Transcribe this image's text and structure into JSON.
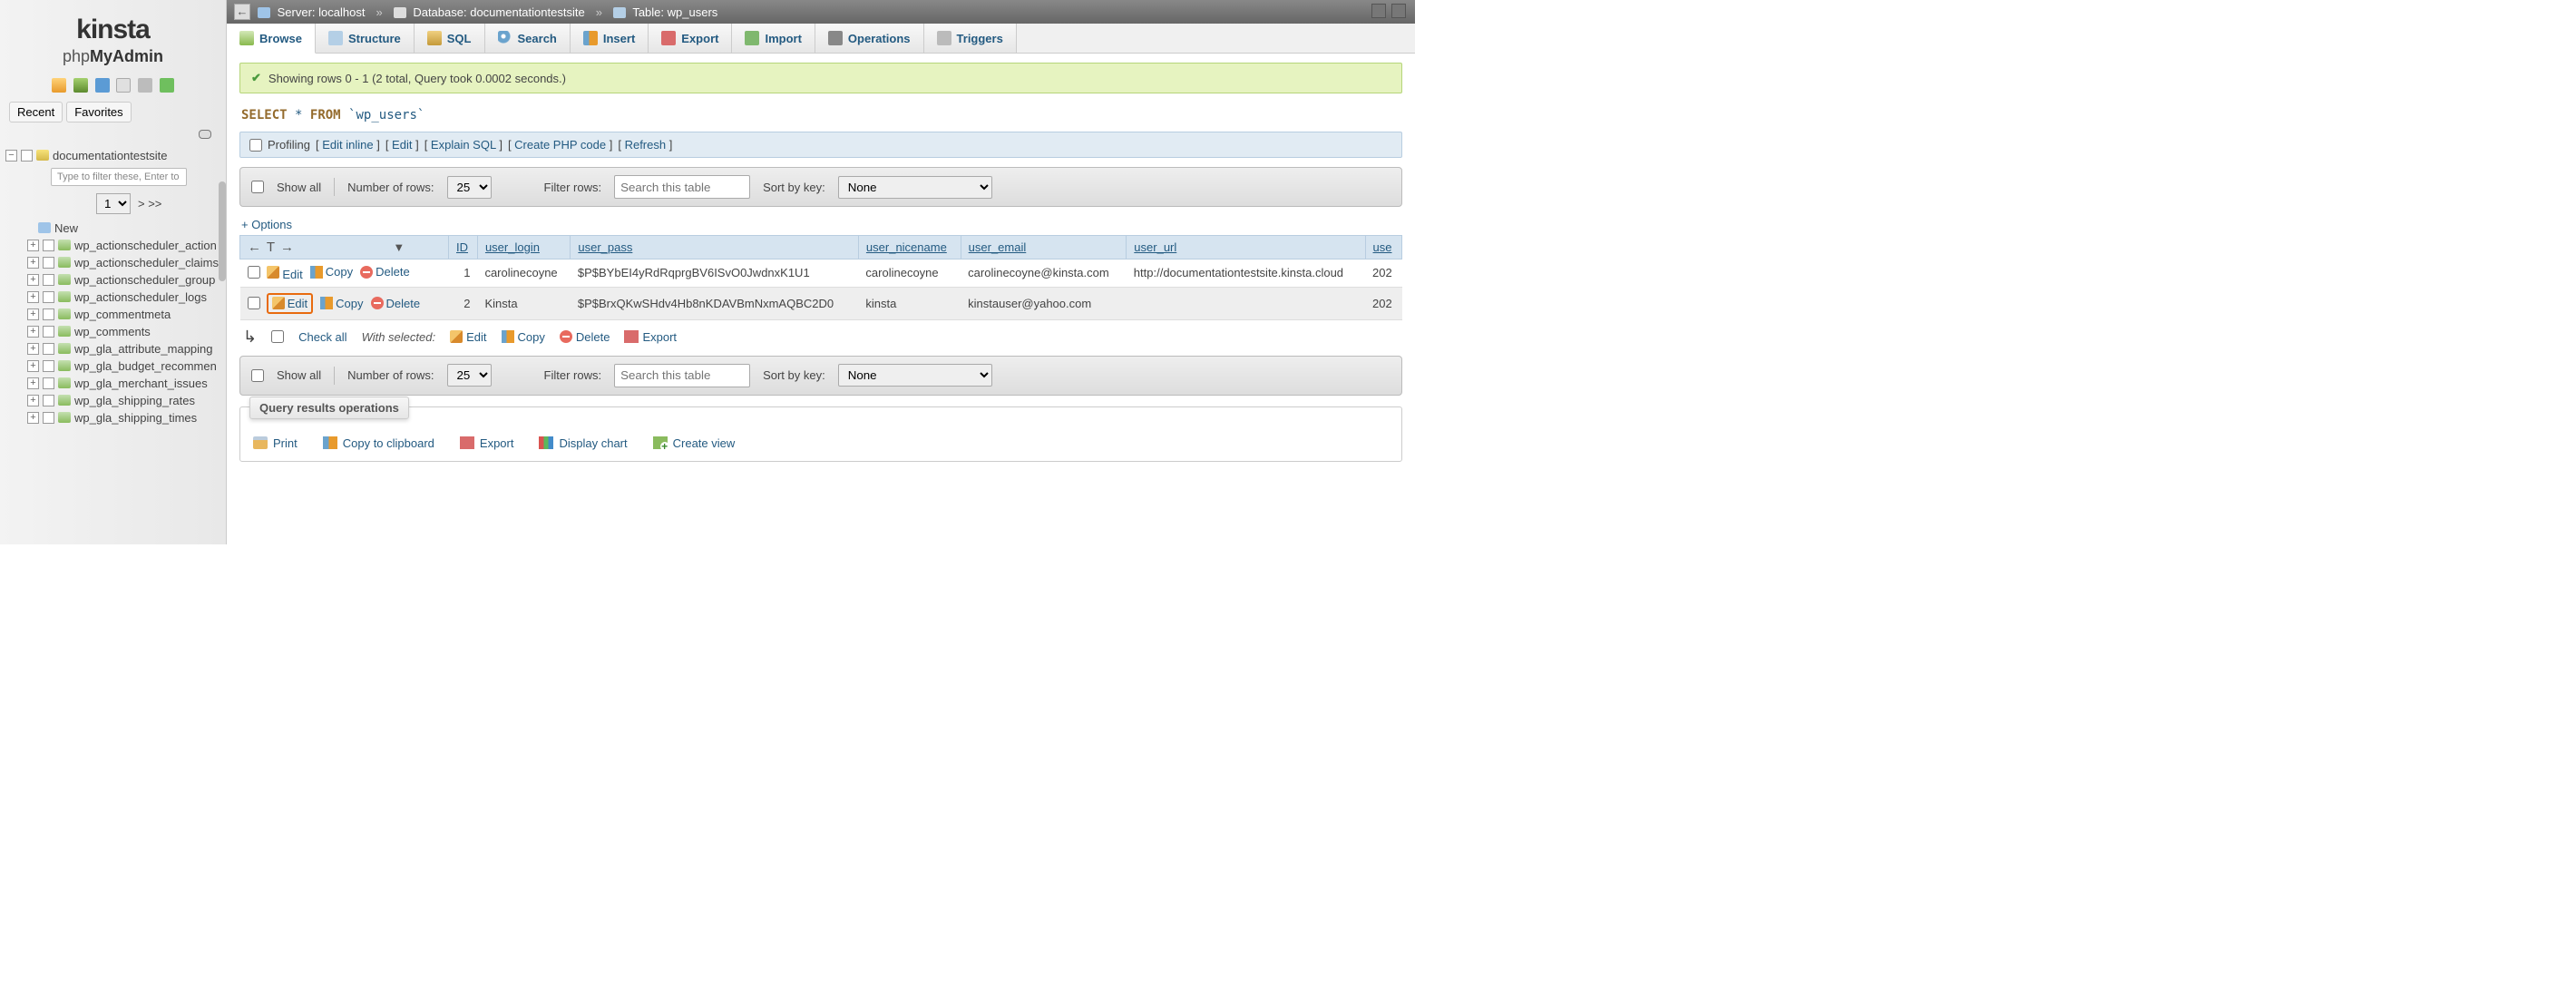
{
  "logo": {
    "brand": "kinsta",
    "product_pre": "php",
    "product_bold": "MyAdmin"
  },
  "sidebar": {
    "tabs": {
      "recent": "Recent",
      "favorites": "Favorites"
    },
    "db": "documentationtestsite",
    "filter_placeholder": "Type to filter these, Enter to se",
    "page_value": "1",
    "page_more": "> >>",
    "new_label": "New",
    "tables": [
      "wp_actionscheduler_action",
      "wp_actionscheduler_claims",
      "wp_actionscheduler_group",
      "wp_actionscheduler_logs",
      "wp_commentmeta",
      "wp_comments",
      "wp_gla_attribute_mapping",
      "wp_gla_budget_recommen",
      "wp_gla_merchant_issues",
      "wp_gla_shipping_rates",
      "wp_gla_shipping_times"
    ]
  },
  "breadcrumb": {
    "server_label": "Server:",
    "server_value": "localhost",
    "db_label": "Database:",
    "db_value": "documentationtestsite",
    "table_label": "Table:",
    "table_value": "wp_users"
  },
  "tabs": [
    "Browse",
    "Structure",
    "SQL",
    "Search",
    "Insert",
    "Export",
    "Import",
    "Operations",
    "Triggers"
  ],
  "success_msg": "Showing rows 0 - 1 (2 total, Query took 0.0002 seconds.)",
  "sql": {
    "select": "SELECT",
    "star": "*",
    "from": "FROM",
    "table": "`wp_users`"
  },
  "query_actions": {
    "profiling": "Profiling",
    "edit_inline": "Edit inline",
    "edit": "Edit",
    "explain": "Explain SQL",
    "create_php": "Create PHP code",
    "refresh": "Refresh"
  },
  "toolbar": {
    "show_all": "Show all",
    "num_rows_label": "Number of rows:",
    "num_rows_value": "25",
    "filter_label": "Filter rows:",
    "filter_placeholder": "Search this table",
    "sort_label": "Sort by key:",
    "sort_value": "None"
  },
  "options": "+ Options",
  "columns": [
    "ID",
    "user_login",
    "user_pass",
    "user_nicename",
    "user_email",
    "user_url",
    "use"
  ],
  "row_actions": {
    "edit": "Edit",
    "copy": "Copy",
    "delete": "Delete"
  },
  "rows": [
    {
      "id": "1",
      "user_login": "carolinecoyne",
      "user_pass": "$P$BYbEI4yRdRqprgBV6ISvO0JwdnxK1U1",
      "user_nicename": "carolinecoyne",
      "user_email": "carolinecoyne@kinsta.com",
      "user_url": "http://documentationtestsite.kinsta.cloud",
      "user_reg": "202"
    },
    {
      "id": "2",
      "user_login": "Kinsta",
      "user_pass": "$P$BrxQKwSHdv4Hb8nKDAVBmNxmAQBC2D0",
      "user_nicename": "kinsta",
      "user_email": "kinstauser@yahoo.com",
      "user_url": "",
      "user_reg": "202"
    }
  ],
  "withsel": {
    "check_all": "Check all",
    "label": "With selected:",
    "edit": "Edit",
    "copy": "Copy",
    "delete": "Delete",
    "export": "Export"
  },
  "qro": {
    "title": "Query results operations",
    "print": "Print",
    "clipboard": "Copy to clipboard",
    "export": "Export",
    "chart": "Display chart",
    "view": "Create view"
  }
}
